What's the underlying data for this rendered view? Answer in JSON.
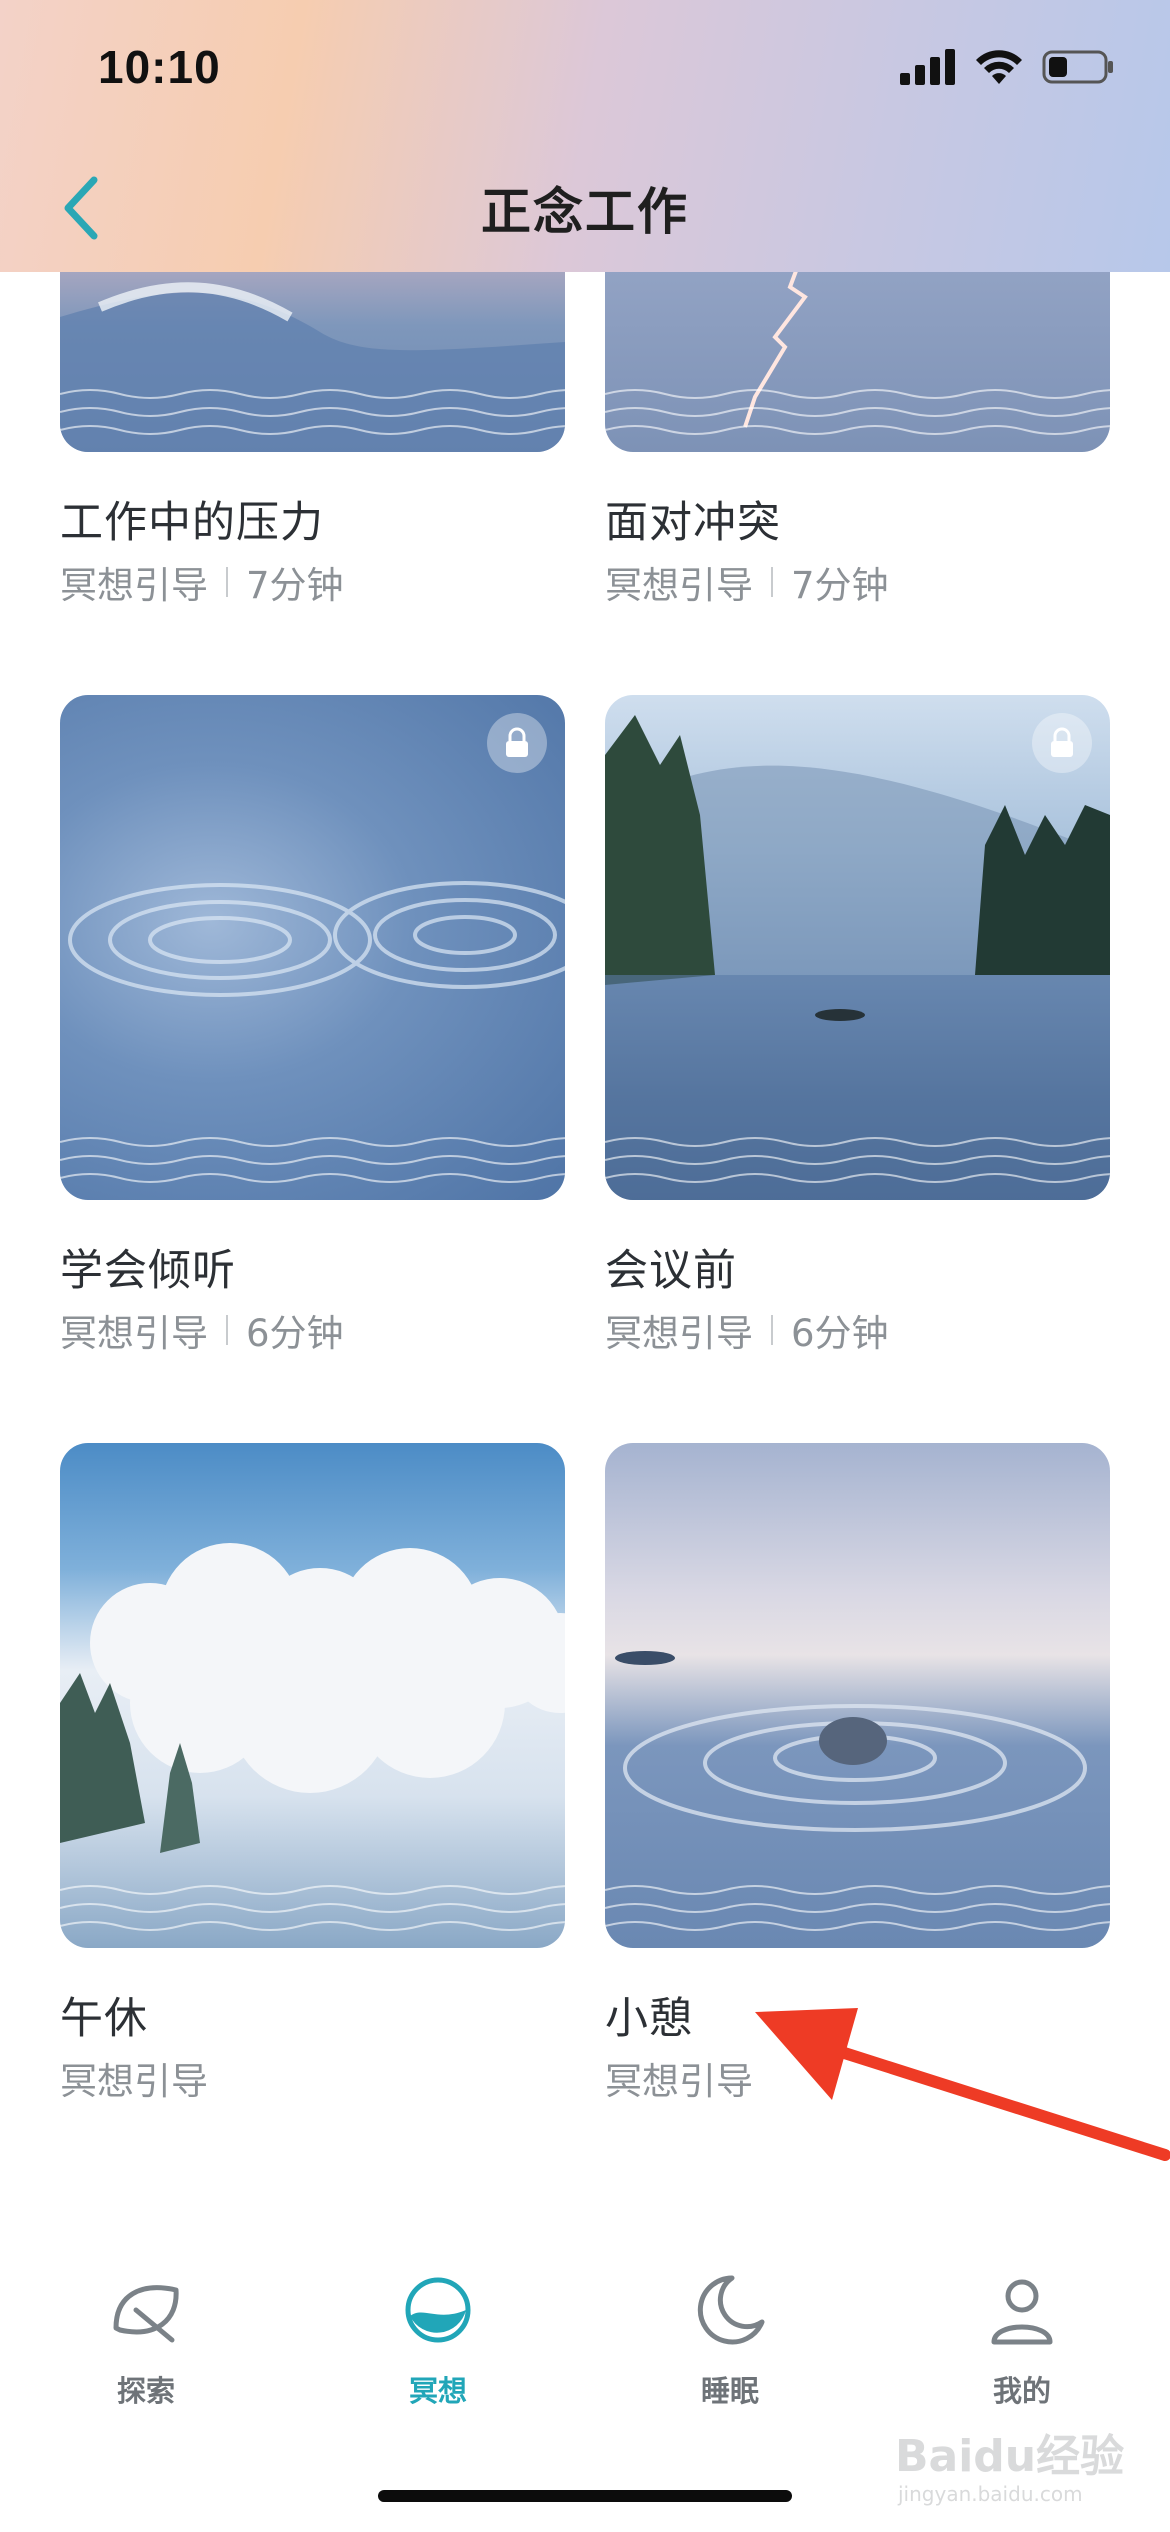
{
  "status": {
    "time": "10:10"
  },
  "header": {
    "title": "正念工作"
  },
  "cards": [
    {
      "title": "工作中的压力",
      "kind": "冥想引导",
      "duration": "7分钟",
      "locked": false
    },
    {
      "title": "面对冲突",
      "kind": "冥想引导",
      "duration": "7分钟",
      "locked": false
    },
    {
      "title": "学会倾听",
      "kind": "冥想引导",
      "duration": "6分钟",
      "locked": true
    },
    {
      "title": "会议前",
      "kind": "冥想引导",
      "duration": "6分钟",
      "locked": true
    },
    {
      "title": "午休",
      "kind": "冥想引导",
      "duration": "",
      "locked": false
    },
    {
      "title": "小憩",
      "kind": "冥想引导",
      "duration": "",
      "locked": false
    }
  ],
  "tabs": [
    {
      "label": "探索",
      "icon": "leaf-icon",
      "active": false
    },
    {
      "label": "冥想",
      "icon": "meditation-wave-icon",
      "active": true
    },
    {
      "label": "睡眠",
      "icon": "moon-icon",
      "active": false
    },
    {
      "label": "我的",
      "icon": "person-icon",
      "active": false
    }
  ],
  "watermark": {
    "main": "Baidu经验",
    "sub": "jingyan.baidu.com"
  },
  "colors": {
    "accent": "#21a6b8",
    "back_chevron": "#2aa7b5",
    "arrow": "#ee3b25"
  }
}
